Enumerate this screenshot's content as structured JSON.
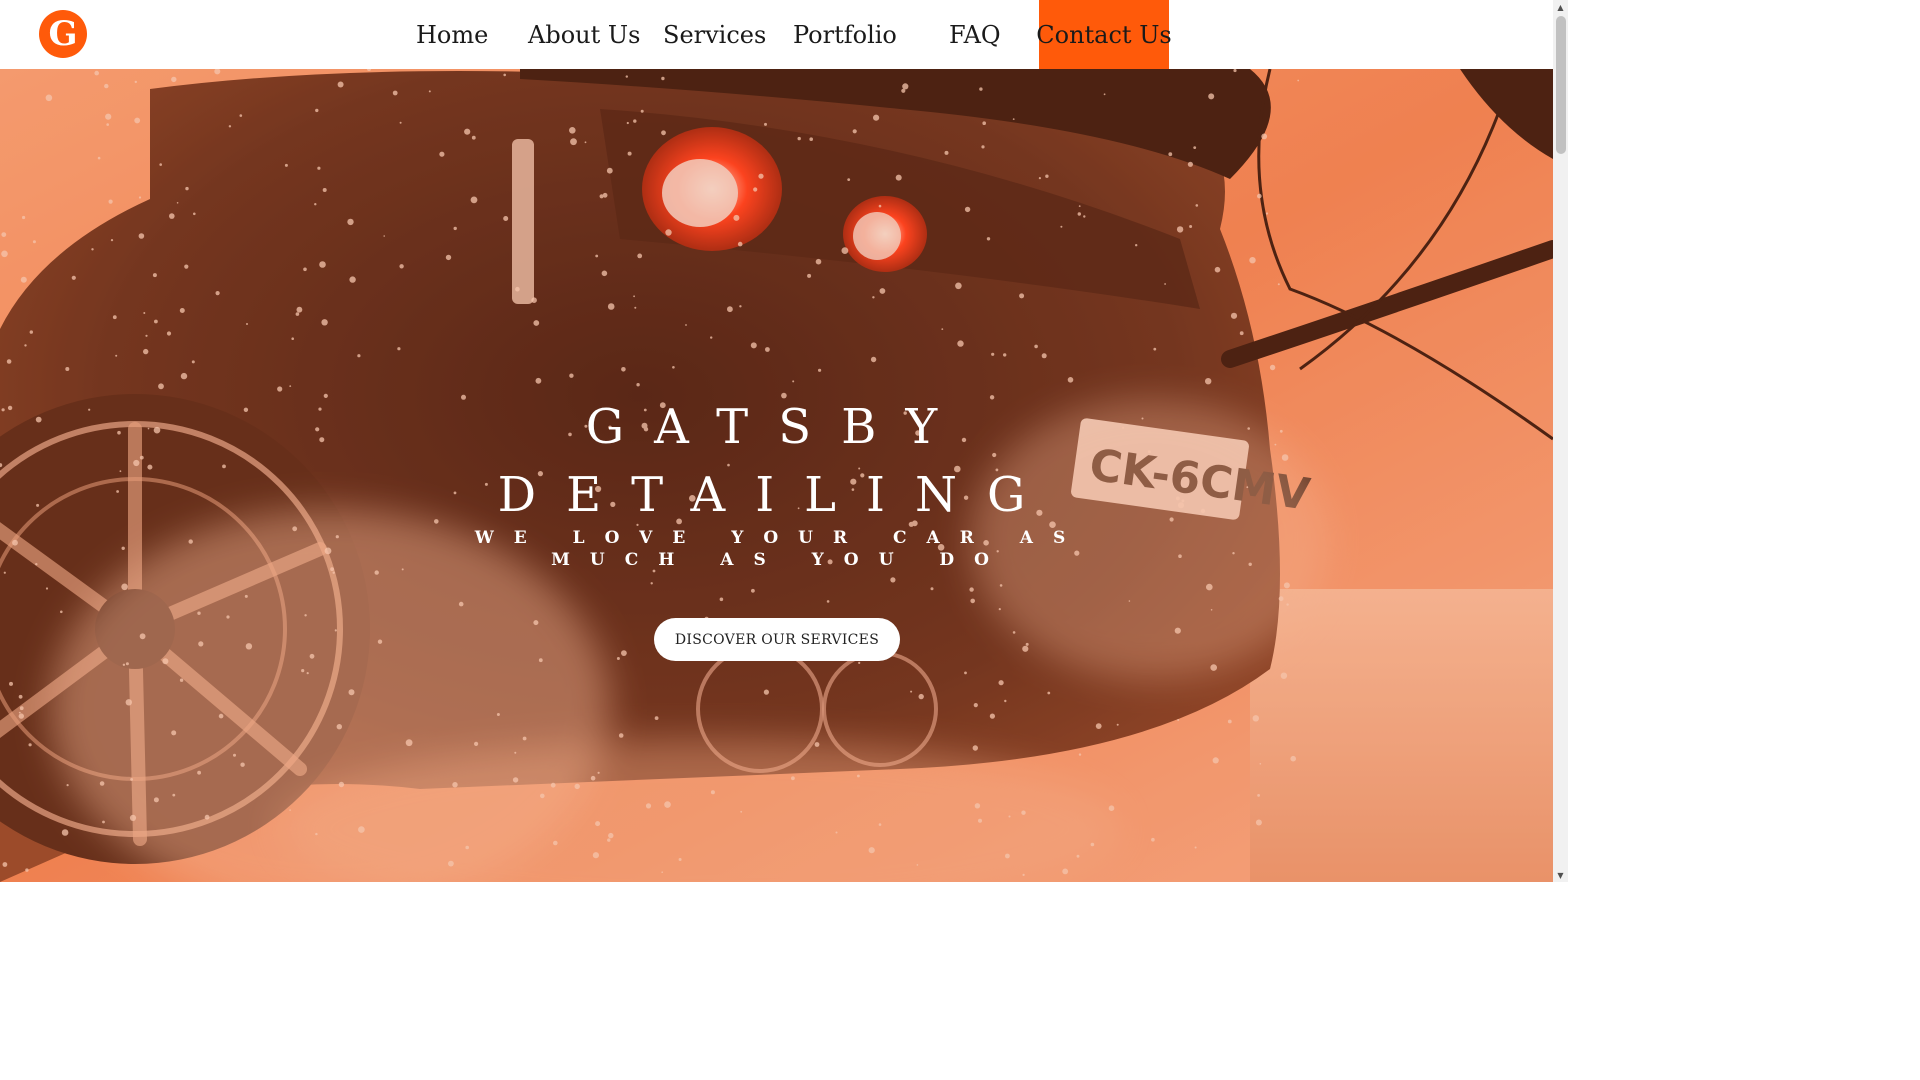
{
  "brand": {
    "logo_letter": "G",
    "logo_icon": "gatsby-g-logo-icon",
    "accent_color": "#ff5a0a"
  },
  "nav": {
    "items": [
      {
        "label": "Home"
      },
      {
        "label": "About Us"
      },
      {
        "label": "Services"
      },
      {
        "label": "Portfolio"
      },
      {
        "label": "FAQ"
      },
      {
        "label": "Contact Us",
        "active": true
      }
    ]
  },
  "hero": {
    "title_line1": "GATSBY",
    "title_line2": "DETAILING",
    "subtitle": "WE LOVE YOUR CAR AS MUCH AS YOU DO",
    "cta_label": "DISCOVER OUR SERVICES",
    "overlay_color": "#f0703a"
  },
  "scrollbar": {
    "up_icon": "scroll-up-arrow-icon",
    "down_icon": "scroll-down-arrow-icon"
  }
}
